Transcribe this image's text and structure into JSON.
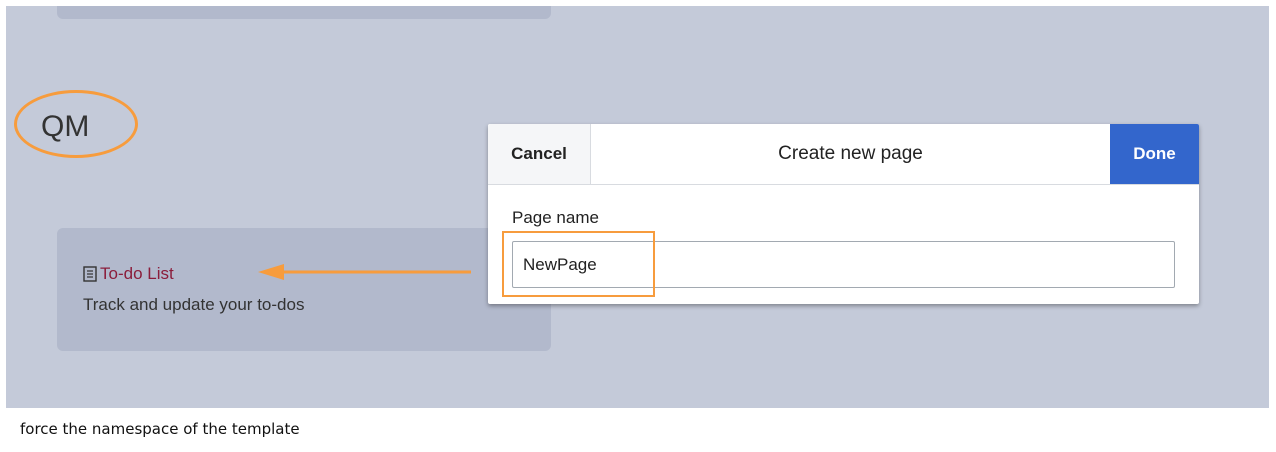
{
  "logo_text": "QM",
  "card": {
    "link_label": "To-do List",
    "description": "Track and update your to-dos",
    "icon": "document-icon"
  },
  "dialog": {
    "cancel_label": "Cancel",
    "title": "Create new page",
    "done_label": "Done",
    "field_label": "Page name",
    "field_value": "NewPage"
  },
  "caption": "force the namespace of the template",
  "colors": {
    "background": "#c4cad9",
    "card": "#b2b9cc",
    "link": "#8b1d3b",
    "done_button": "#3366cc",
    "annotation": "#f79c3d"
  }
}
